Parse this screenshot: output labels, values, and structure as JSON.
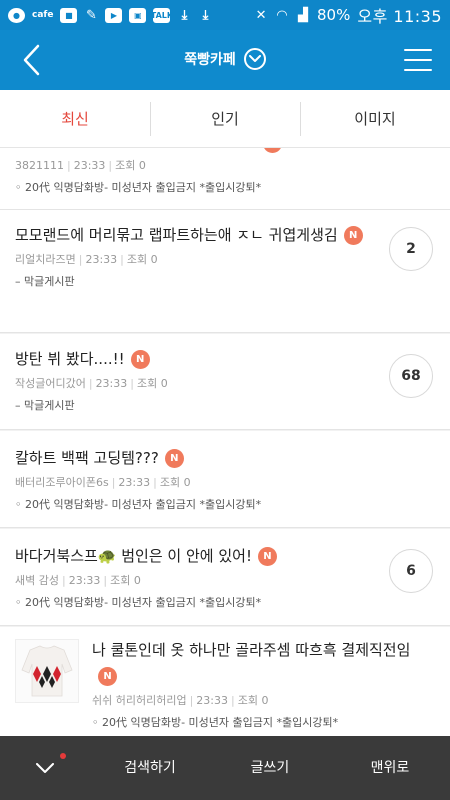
{
  "status_bar": {
    "cafe_label": "cafe",
    "talk_label": "TALK",
    "battery": "80%",
    "time": "오후 11:35"
  },
  "app_bar": {
    "title": "쭉빵카페"
  },
  "tabs": [
    {
      "label": "최신",
      "active": true
    },
    {
      "label": "인기",
      "active": false
    },
    {
      "label": "이미지",
      "active": false
    }
  ],
  "posts": [
    {
      "title": "",
      "new_badge": "N",
      "author": "3821111",
      "time": "23:33",
      "views": "조회 0",
      "board": "◦ 20代 익명담화방- 미성년자 출입금지 *출입시강퇴*",
      "comments": ""
    },
    {
      "title": "모모랜드에 머리묶고 랩파트하는애 ㅈㄴ 귀엽게생김",
      "new_badge": "N",
      "author": "리얼치라즈면",
      "time": "23:33",
      "views": "조회 0",
      "board": "– 막글게시판",
      "comments": "2"
    },
    {
      "title": "방탄 뷔 봤다....!!",
      "new_badge": "N",
      "author": "작성글어디갔어",
      "time": "23:33",
      "views": "조회 0",
      "board": "– 막글게시판",
      "comments": "68"
    },
    {
      "title": "칼하트 백팩 고딩템???",
      "new_badge": "N",
      "author": "배터리조루아이폰6s",
      "time": "23:33",
      "views": "조회 0",
      "board": "◦ 20代 익명담화방- 미성년자 출입금지 *출입시강퇴*",
      "comments": ""
    },
    {
      "title": "바다거북스프🐢 범인은 이 안에 있어!",
      "new_badge": "N",
      "author": "새벽 감성",
      "time": "23:33",
      "views": "조회 0",
      "board": "◦ 20代 익명담화방- 미성년자 출입금지 *출입시강퇴*",
      "comments": "6"
    },
    {
      "title": "나 쿨톤인데 옷 하나만 골라주셈 따흐흑 결제직전임",
      "new_badge": "N",
      "author": "쉬쉬 허리허리허리업",
      "time": "23:33",
      "views": "조회 0",
      "board": "◦ 20代 익명담화방- 미성년자 출입금지 *출입시강퇴*",
      "comments": ""
    }
  ],
  "bottom_bar": {
    "search": "검색하기",
    "write": "글쓰기",
    "top": "맨위로"
  },
  "colors": {
    "header_blue": "#0f8acd",
    "active_tab": "#e4473c",
    "new_badge": "#f07a5c",
    "bottom_bar": "#3a3a3a"
  },
  "icons": {
    "back": "chevron-left-icon",
    "dropdown": "chevron-down-circle-icon",
    "menu": "hamburger-menu-icon",
    "bottom_toggle": "chevron-down-icon"
  }
}
